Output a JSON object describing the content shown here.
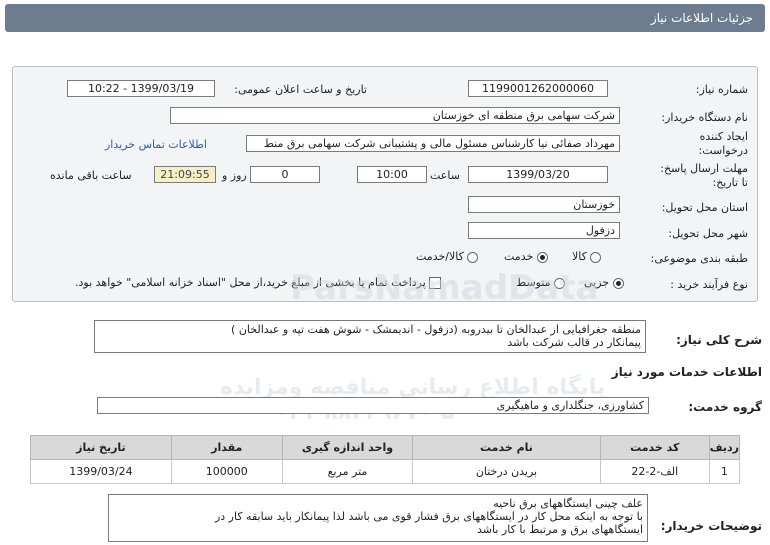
{
  "title": "جزئیات اطلاعات نیاز",
  "fields": {
    "need_number_label": "شماره نیاز:",
    "need_number": "1199001262000060",
    "announce_label": "تاریخ و ساعت اعلان عمومی:",
    "announce_value": "1399/03/19 - 10:22",
    "buyer_label": "نام دستگاه خریدار:",
    "buyer_value": "شرکت سهامی برق منطقه ای خوزستان",
    "creator_label1": "ایجاد کننده",
    "creator_label2": "درخواست:",
    "creator_value": "مهرداد صفائی نیا کارشناس مسئول مالی و پشتیبانی شرکت سهامی برق منط",
    "contact_link": "اطلاعات تماس خریدار",
    "deadline_label1": "مهلت ارسال پاسخ:",
    "deadline_label2": "تا تاریخ:",
    "deadline_date": "1399/03/20",
    "time_label": "ساعت",
    "deadline_time": "10:00",
    "days_value": "0",
    "days_label": "روز و",
    "remaining_time": "21:09:55",
    "remaining_label": "ساعت باقی مانده",
    "province_label": "استان محل تحویل:",
    "province_value": "خوزستان",
    "city_label": "شهر محل تحویل:",
    "city_value": "دزفول",
    "category_label": "طبقه بندی موضوعی:",
    "category_options": [
      "کالا",
      "خدمت",
      "کالا/خدمت"
    ],
    "category_selected": "خدمت",
    "process_label": "نوع فرآیند خرید :",
    "process_options": [
      "جزیی",
      "متوسط"
    ],
    "process_selected": "جزیی",
    "payment_note": "پرداخت تمام یا بخشی از مبلغ خرید،از محل \"اسناد خزانه اسلامی\" خواهد بود."
  },
  "summary": {
    "label": "شرح کلی نیاز:",
    "line1": "منطقه جغرافیایی از عبدالخان تا بیدروبه (دزفول - اندیمشک - شوش هفت تپه  و عبدالخان )",
    "line2": "پیمانکار  در قالب  شرکت باشد"
  },
  "services_heading": "اطلاعات خدمات مورد نیاز",
  "service_group_label": "گروه خدمت:",
  "service_group_value": "کشاورزی، جنگلداری و ماهیگیری",
  "table": {
    "headers": [
      "ردیف",
      "کد خدمت",
      "نام خدمت",
      "واحد اندازه گیری",
      "مقدار",
      "تاریخ نیاز"
    ],
    "rows": [
      [
        "1",
        "الف-2-22",
        "بریدن درختان",
        "متر مربع",
        "100000",
        "1399/03/24"
      ]
    ]
  },
  "buyer_notes": {
    "label": "توضیحات خریدار:",
    "line1": "علف چینی ایستگاههای برق ناحیه",
    "line2": "با توجه به اینکه محل کار در ایستگاههای برق فشار قوی می باشد لذا پیمانکار باید سابقه کار  در",
    "line3": "ایستگاههای برق و مرتبط با کار باشد"
  },
  "watermark": {
    "line1": "ParsNamadData",
    "line2": "پایگاه اطلاع رسانی مناقصه ومزایده",
    "line3": "۰۲۱-۸۸۳۴۹۶۷۰-۵"
  }
}
